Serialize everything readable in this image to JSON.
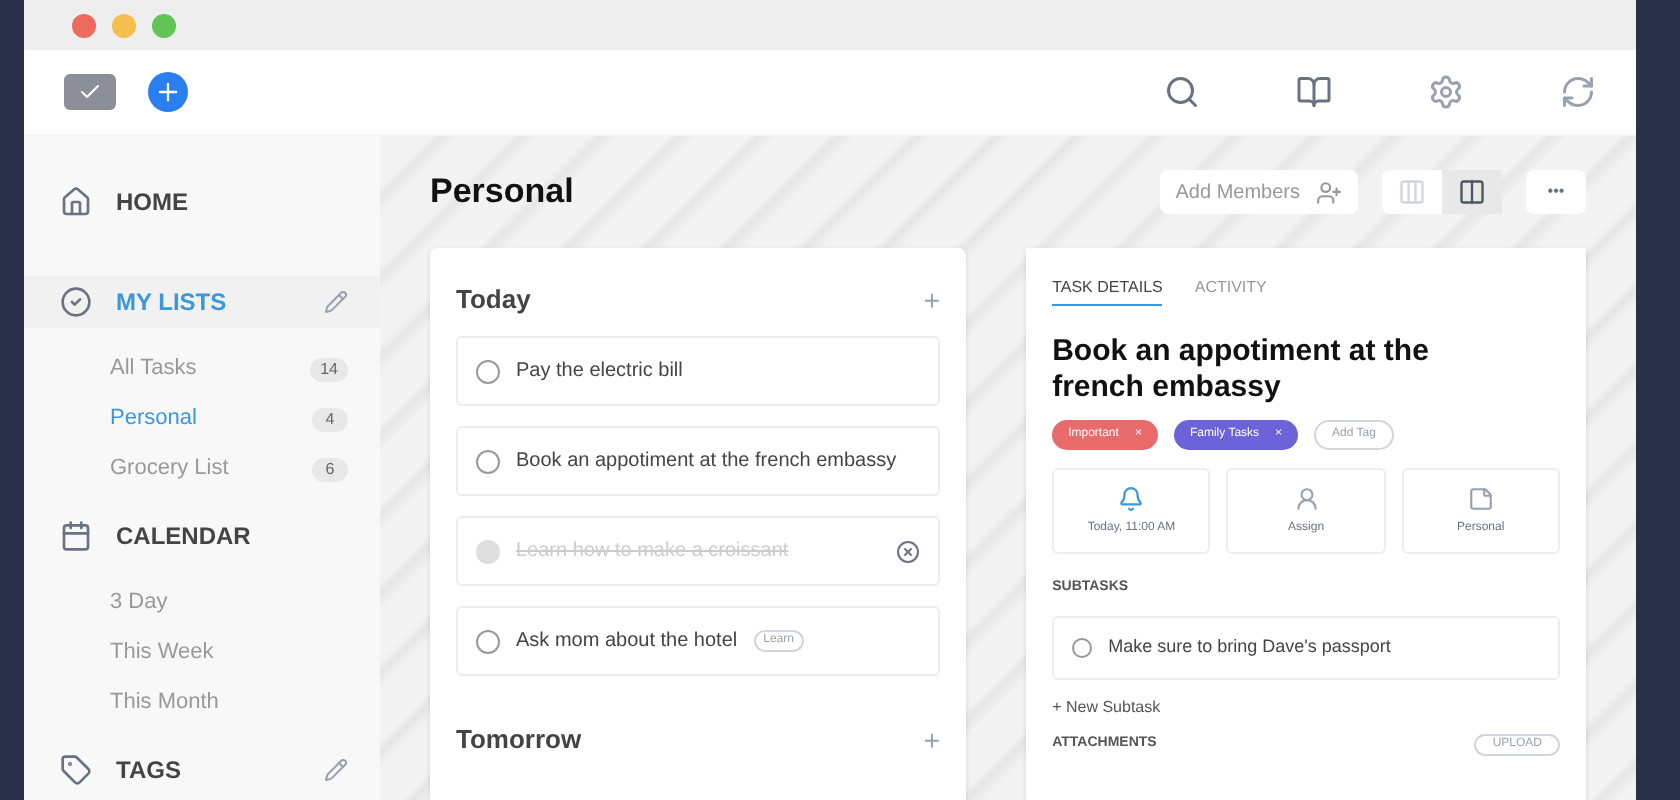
{
  "sidebar": {
    "sections": [
      {
        "label": "HOME",
        "selected": false,
        "editable": false
      },
      {
        "label": "MY LISTS",
        "selected": true,
        "editable": true,
        "items": [
          {
            "label": "All Tasks",
            "count": "14",
            "selected": false
          },
          {
            "label": "Personal",
            "count": "4",
            "selected": true
          },
          {
            "label": "Grocery List",
            "count": "6",
            "selected": false
          }
        ]
      },
      {
        "label": "CALENDAR",
        "selected": false,
        "editable": false,
        "items": [
          {
            "label": "3 Day",
            "selected": false
          },
          {
            "label": "This Week",
            "selected": false
          },
          {
            "label": "This Month",
            "selected": false
          }
        ]
      },
      {
        "label": "TAGS",
        "selected": false,
        "editable": true
      }
    ]
  },
  "header": {
    "title": "Personal",
    "add_members": "Add Members",
    "more": "•••",
    "views": [
      {
        "selected": false
      },
      {
        "selected": true
      }
    ]
  },
  "groups": [
    {
      "title": "Today",
      "add": "+",
      "tasks": [
        {
          "text": "Pay the electric bill",
          "done": false
        },
        {
          "text": "Book an appotiment at the french embassy",
          "done": false
        },
        {
          "text": "Learn how to make a croissant",
          "done": true
        },
        {
          "text": "Ask mom about the hotel",
          "done": false,
          "tag": "Learn"
        }
      ]
    },
    {
      "title": "Tomorrow",
      "add": "+"
    }
  ],
  "detail": {
    "tabs": [
      {
        "label": "TASK DETAILS",
        "selected": true
      },
      {
        "label": "ACTIVITY",
        "selected": false
      }
    ],
    "title": "Book an appotiment at the french embassy",
    "tags": [
      {
        "label": "Important",
        "color": "#e86a6a"
      },
      {
        "label": "Family Tasks",
        "color": "#6c63d9"
      }
    ],
    "tag_close": "×",
    "add_tag": "Add Tag",
    "actions": [
      {
        "label": "Today, 11:00 AM",
        "active": true
      },
      {
        "label": "Assign",
        "active": false
      },
      {
        "label": "Personal",
        "active": false
      }
    ],
    "subtasks_title": "SUBTASKS",
    "subtasks": [
      {
        "text": "Make sure to bring Dave's passport",
        "done": false
      }
    ],
    "new_subtask": "+ New Subtask",
    "attachments_title": "ATTACHMENTS",
    "upload": "UPLOAD"
  }
}
